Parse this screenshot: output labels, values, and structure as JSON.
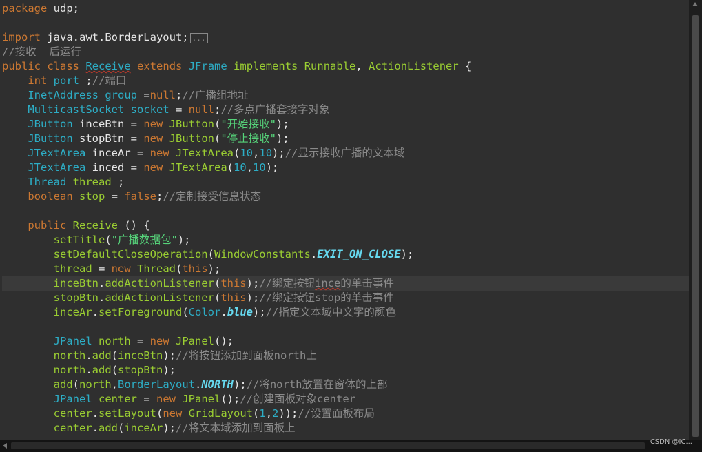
{
  "code": [
    {
      "tokens": [
        [
          "package",
          "kw"
        ],
        [
          " udp;",
          ""
        ]
      ]
    },
    {
      "tokens": []
    },
    {
      "tokens": [
        [
          "import",
          "kw"
        ],
        [
          " java.awt.BorderLayout;",
          ""
        ],
        [
          "...",
          "box"
        ]
      ]
    },
    {
      "tokens": [
        [
          "//接收  后运行",
          "cmt"
        ]
      ]
    },
    {
      "tokens": [
        [
          "public",
          "kw"
        ],
        [
          " ",
          ""
        ],
        [
          "class",
          "kw"
        ],
        [
          " ",
          ""
        ],
        [
          "Receive",
          "type under"
        ],
        [
          " ",
          ""
        ],
        [
          "extends",
          "kw"
        ],
        [
          " ",
          ""
        ],
        [
          "JFrame",
          "type"
        ],
        [
          " ",
          ""
        ],
        [
          "implements",
          "green"
        ],
        [
          " ",
          ""
        ],
        [
          "Runnable",
          "green"
        ],
        [
          ", ",
          ""
        ],
        [
          "ActionListener",
          "green"
        ],
        [
          " {",
          ""
        ]
      ]
    },
    {
      "tokens": [
        [
          "    ",
          ""
        ],
        [
          "int",
          "kw"
        ],
        [
          " ",
          ""
        ],
        [
          "port",
          "type"
        ],
        [
          " ;",
          ""
        ],
        [
          "//端口",
          "cmt"
        ]
      ]
    },
    {
      "tokens": [
        [
          "    ",
          ""
        ],
        [
          "InetAddress",
          "type"
        ],
        [
          " ",
          ""
        ],
        [
          "group",
          "type"
        ],
        [
          " =",
          ""
        ],
        [
          "null",
          "kw"
        ],
        [
          ";",
          ""
        ],
        [
          "//广播组地址",
          "cmt"
        ]
      ]
    },
    {
      "tokens": [
        [
          "    ",
          ""
        ],
        [
          "MulticastSocket",
          "type"
        ],
        [
          " ",
          ""
        ],
        [
          "socket",
          "type"
        ],
        [
          " = ",
          ""
        ],
        [
          "null",
          "kw"
        ],
        [
          ";",
          ""
        ],
        [
          "//多点广播套接字对象",
          "cmt"
        ]
      ]
    },
    {
      "tokens": [
        [
          "    ",
          ""
        ],
        [
          "JButton",
          "type"
        ],
        [
          " inceBtn = ",
          ""
        ],
        [
          "new",
          "kw"
        ],
        [
          " ",
          ""
        ],
        [
          "JButton",
          "green"
        ],
        [
          "(",
          ""
        ],
        [
          "\"开始接收\"",
          "str"
        ],
        [
          ");",
          ""
        ]
      ]
    },
    {
      "tokens": [
        [
          "    ",
          ""
        ],
        [
          "JButton",
          "type"
        ],
        [
          " stopBtn = ",
          ""
        ],
        [
          "new",
          "kw"
        ],
        [
          " ",
          ""
        ],
        [
          "JButton",
          "green"
        ],
        [
          "(",
          ""
        ],
        [
          "\"停止接收\"",
          "str"
        ],
        [
          ");",
          ""
        ]
      ]
    },
    {
      "tokens": [
        [
          "    ",
          ""
        ],
        [
          "JTextArea",
          "type"
        ],
        [
          " inceAr = ",
          ""
        ],
        [
          "new",
          "kw"
        ],
        [
          " ",
          ""
        ],
        [
          "JTextArea",
          "green"
        ],
        [
          "(",
          ""
        ],
        [
          "10",
          "num"
        ],
        [
          ",",
          ""
        ],
        [
          "10",
          "num"
        ],
        [
          ");",
          ""
        ],
        [
          "//显示接收广播的文本域",
          "cmt"
        ]
      ]
    },
    {
      "tokens": [
        [
          "    ",
          ""
        ],
        [
          "JTextArea",
          "type"
        ],
        [
          " inced = ",
          ""
        ],
        [
          "new",
          "kw"
        ],
        [
          " ",
          ""
        ],
        [
          "JTextArea",
          "green"
        ],
        [
          "(",
          ""
        ],
        [
          "10",
          "num"
        ],
        [
          ",",
          ""
        ],
        [
          "10",
          "num"
        ],
        [
          ");",
          ""
        ]
      ]
    },
    {
      "tokens": [
        [
          "    ",
          ""
        ],
        [
          "Thread",
          "type"
        ],
        [
          " ",
          ""
        ],
        [
          "thread",
          "green"
        ],
        [
          " ;",
          ""
        ]
      ]
    },
    {
      "tokens": [
        [
          "    ",
          ""
        ],
        [
          "boolean",
          "kw"
        ],
        [
          " ",
          ""
        ],
        [
          "stop",
          "green"
        ],
        [
          " = ",
          ""
        ],
        [
          "false",
          "kw"
        ],
        [
          ";",
          ""
        ],
        [
          "//定制接受信息状态",
          "cmt"
        ]
      ]
    },
    {
      "tokens": []
    },
    {
      "tokens": [
        [
          "    ",
          ""
        ],
        [
          "public",
          "kw"
        ],
        [
          " ",
          ""
        ],
        [
          "Receive",
          "green"
        ],
        [
          " () {",
          ""
        ]
      ]
    },
    {
      "tokens": [
        [
          "        ",
          ""
        ],
        [
          "setTitle",
          "green"
        ],
        [
          "(",
          ""
        ],
        [
          "\"广播数据包\"",
          "str"
        ],
        [
          ");",
          ""
        ]
      ]
    },
    {
      "tokens": [
        [
          "        ",
          ""
        ],
        [
          "setDefaultCloseOperation",
          "green"
        ],
        [
          "(",
          ""
        ],
        [
          "WindowConstants",
          "green"
        ],
        [
          ".",
          ""
        ],
        [
          "EXIT_ON_CLOSE",
          "const"
        ],
        [
          ");",
          ""
        ]
      ]
    },
    {
      "tokens": [
        [
          "        ",
          ""
        ],
        [
          "thread",
          "green"
        ],
        [
          " = ",
          ""
        ],
        [
          "new",
          "kw"
        ],
        [
          " ",
          ""
        ],
        [
          "Thread",
          "green"
        ],
        [
          "(",
          ""
        ],
        [
          "this",
          "kw"
        ],
        [
          ");",
          ""
        ]
      ]
    },
    {
      "current": true,
      "tokens": [
        [
          "        ",
          ""
        ],
        [
          "inceBtn",
          "green"
        ],
        [
          ".",
          ""
        ],
        [
          "addActionListener",
          "green"
        ],
        [
          "(",
          ""
        ],
        [
          "this",
          "kw"
        ],
        [
          ");",
          ""
        ],
        [
          "//绑定按钮",
          "cmt"
        ],
        [
          "ince",
          "cmt under"
        ],
        [
          "的单击事件",
          "cmt"
        ]
      ]
    },
    {
      "tokens": [
        [
          "        ",
          ""
        ],
        [
          "stopBtn",
          "green"
        ],
        [
          ".",
          ""
        ],
        [
          "addActionListener",
          "green"
        ],
        [
          "(",
          ""
        ],
        [
          "this",
          "kw"
        ],
        [
          ");",
          ""
        ],
        [
          "//绑定按钮stop的单击事件",
          "cmt"
        ]
      ]
    },
    {
      "tokens": [
        [
          "        ",
          ""
        ],
        [
          "inceAr",
          "green"
        ],
        [
          ".",
          ""
        ],
        [
          "setForeground",
          "green"
        ],
        [
          "(",
          ""
        ],
        [
          "Color",
          "type"
        ],
        [
          ".",
          ""
        ],
        [
          "blue",
          "const"
        ],
        [
          ");",
          ""
        ],
        [
          "//指定文本域中文字的颜色",
          "cmt"
        ]
      ]
    },
    {
      "tokens": []
    },
    {
      "tokens": [
        [
          "        ",
          ""
        ],
        [
          "JPanel",
          "type"
        ],
        [
          " ",
          ""
        ],
        [
          "north",
          "green"
        ],
        [
          " = ",
          ""
        ],
        [
          "new",
          "kw"
        ],
        [
          " ",
          ""
        ],
        [
          "JPanel",
          "green"
        ],
        [
          "();",
          ""
        ]
      ]
    },
    {
      "tokens": [
        [
          "        ",
          ""
        ],
        [
          "north",
          "green"
        ],
        [
          ".",
          ""
        ],
        [
          "add",
          "green"
        ],
        [
          "(",
          ""
        ],
        [
          "inceBtn",
          "green"
        ],
        [
          ");",
          ""
        ],
        [
          "//将按钮添加到面板north上",
          "cmt"
        ]
      ]
    },
    {
      "tokens": [
        [
          "        ",
          ""
        ],
        [
          "north",
          "green"
        ],
        [
          ".",
          ""
        ],
        [
          "add",
          "green"
        ],
        [
          "(",
          ""
        ],
        [
          "stopBtn",
          "green"
        ],
        [
          ");",
          ""
        ]
      ]
    },
    {
      "tokens": [
        [
          "        ",
          ""
        ],
        [
          "add",
          "green"
        ],
        [
          "(",
          ""
        ],
        [
          "north",
          "green"
        ],
        [
          ",",
          ""
        ],
        [
          "BorderLayout",
          "type"
        ],
        [
          ".",
          ""
        ],
        [
          "NORTH",
          "const"
        ],
        [
          ");",
          ""
        ],
        [
          "//将north放置在窗体的上部",
          "cmt"
        ]
      ]
    },
    {
      "tokens": [
        [
          "        ",
          ""
        ],
        [
          "JPanel",
          "type"
        ],
        [
          " ",
          ""
        ],
        [
          "center",
          "green"
        ],
        [
          " = ",
          ""
        ],
        [
          "new",
          "kw"
        ],
        [
          " ",
          ""
        ],
        [
          "JPanel",
          "green"
        ],
        [
          "();",
          ""
        ],
        [
          "//创建面板对象center",
          "cmt"
        ]
      ]
    },
    {
      "tokens": [
        [
          "        ",
          ""
        ],
        [
          "center",
          "green"
        ],
        [
          ".",
          ""
        ],
        [
          "setLayout",
          "green"
        ],
        [
          "(",
          ""
        ],
        [
          "new",
          "kw"
        ],
        [
          " ",
          ""
        ],
        [
          "GridLayout",
          "green"
        ],
        [
          "(",
          ""
        ],
        [
          "1",
          "num"
        ],
        [
          ",",
          ""
        ],
        [
          "2",
          "num"
        ],
        [
          "));",
          ""
        ],
        [
          "//设置面板布局",
          "cmt"
        ]
      ]
    },
    {
      "tokens": [
        [
          "        ",
          ""
        ],
        [
          "center",
          "green"
        ],
        [
          ".",
          ""
        ],
        [
          "add",
          "green"
        ],
        [
          "(",
          ""
        ],
        [
          "inceAr",
          "green"
        ],
        [
          ");",
          ""
        ],
        [
          "//将文本域添加到面板上",
          "cmt"
        ]
      ]
    }
  ],
  "colors": {
    "background": "#2f2f2f",
    "keyword": "#cc7832",
    "type": "#2dadc5",
    "string": "#56d37a",
    "comment": "#8a8a8a",
    "identifier": "#9acd32"
  },
  "watermark": "CSDN @IC..."
}
